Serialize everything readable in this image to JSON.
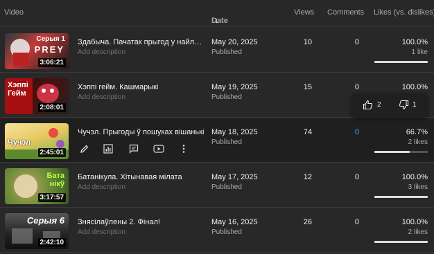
{
  "header": {
    "video": "Video",
    "date": "Date",
    "date_arrow": "↓",
    "views": "Views",
    "comments": "Comments",
    "likes": "Likes (vs. dislikes)"
  },
  "videos": [
    {
      "title": "Здабыча. Пачатак прыгод у найлепш…",
      "description": "Add description",
      "duration": "3:06:21",
      "thumb_text": "Серыя 1",
      "thumb_text2": "PREY",
      "date": "May 20, 2025",
      "status": "Published",
      "views": "10",
      "comments": "0",
      "likes_pct": "100.0%",
      "likes_count": "1 like",
      "likes_ratio": 1.0
    },
    {
      "title": "Хэппі гейм. Кашмарыкі",
      "description": "Add description",
      "duration": "2:08:01",
      "thumb_text": "Хэппі",
      "thumb_text2": "Гейм",
      "date": "May 19, 2025",
      "status": "Published",
      "views": "15",
      "comments": "0",
      "likes_pct": "100.0%",
      "likes_count": "",
      "likes_ratio": 1.0
    },
    {
      "title": "Чучэл. Прыгоды ў пошуках вішанькі",
      "description": "",
      "duration": "2:45:01",
      "thumb_text": "Чучэл",
      "thumb_text2": "",
      "date": "May 18, 2025",
      "status": "Published",
      "views": "74",
      "comments": "0",
      "likes_pct": "66.7%",
      "likes_count": "2 likes",
      "likes_ratio": 0.667
    },
    {
      "title": "Батанікула. Хітынавая мілата",
      "description": "Add description",
      "duration": "3:17:57",
      "thumb_text": "Бата",
      "thumb_text2": "нікў",
      "date": "May 17, 2025",
      "status": "Published",
      "views": "12",
      "comments": "0",
      "likes_pct": "100.0%",
      "likes_count": "3 likes",
      "likes_ratio": 1.0
    },
    {
      "title": "Знясілаўлены 2. Фінал!",
      "description": "Add description",
      "duration": "2:42:10",
      "thumb_text": "Серыя 6",
      "thumb_text2": "",
      "date": "May 16, 2025",
      "status": "Published",
      "views": "26",
      "comments": "0",
      "likes_pct": "100.0%",
      "likes_count": "2 likes",
      "likes_ratio": 1.0
    }
  ],
  "tooltip": {
    "likes": "2",
    "dislikes": "1"
  },
  "hover_actions": [
    "pencil-icon",
    "analytics-icon",
    "comments-icon",
    "youtube-icon",
    "more-vert-icon"
  ],
  "colors": {
    "background": "#282828",
    "link": "#3ea6ff",
    "bar_fill": "#dddddd"
  }
}
